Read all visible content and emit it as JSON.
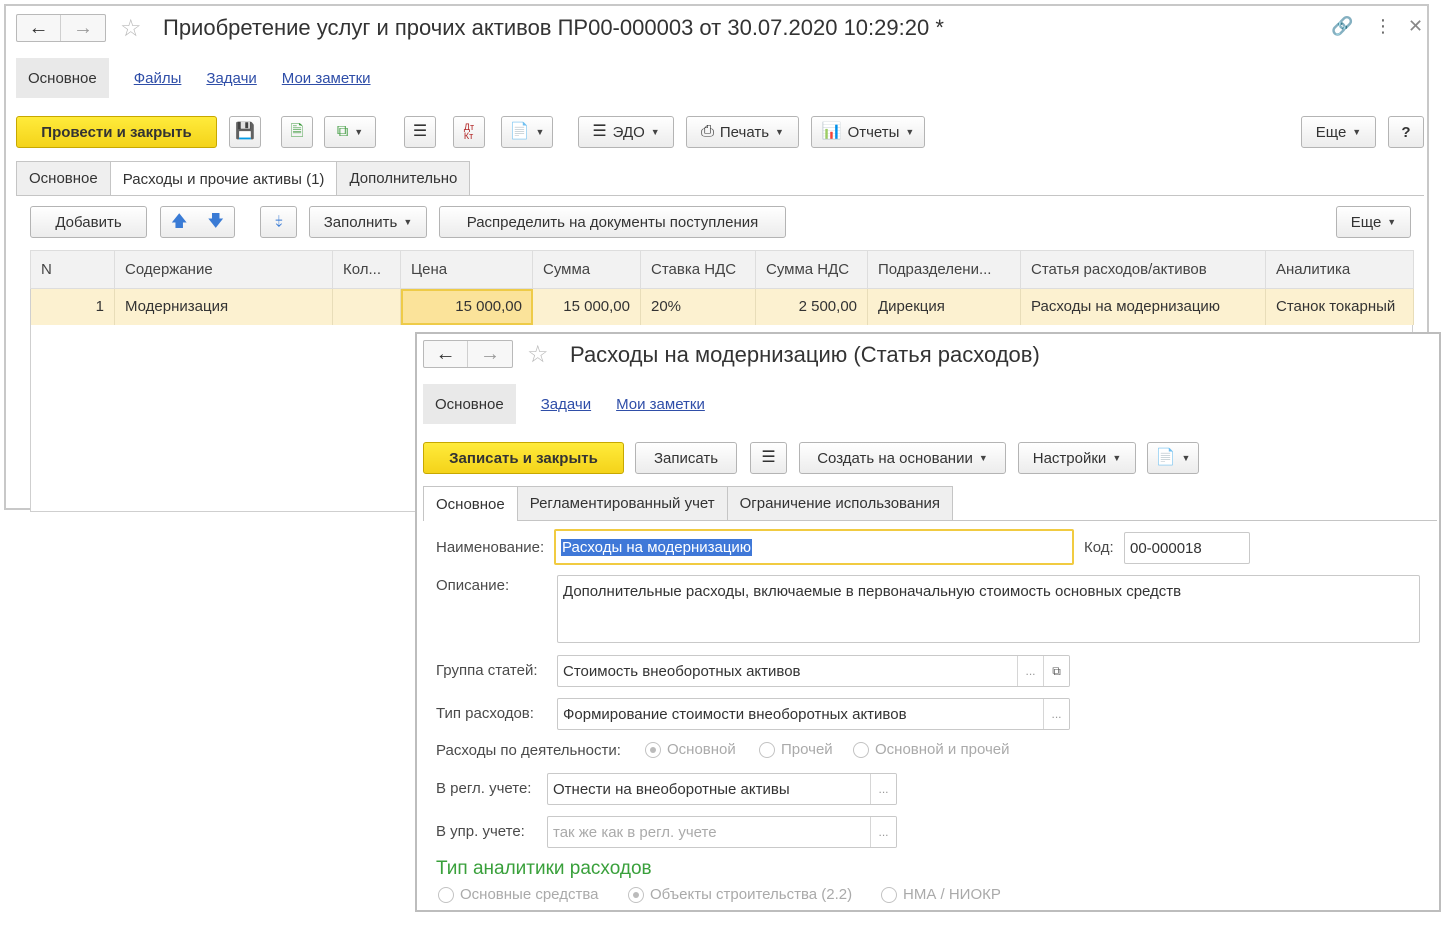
{
  "doc": {
    "title": "Приобретение услуг и прочих активов ПР00-000003 от 30.07.2020 10:29:20 *",
    "nav": {
      "current": "Основное",
      "links": [
        "Файлы",
        "Задачи",
        "Мои заметки"
      ]
    },
    "toolbar": {
      "post_close": "Провести и закрыть",
      "edo": "ЭДО",
      "print": "Печать",
      "reports": "Отчеты",
      "more": "Еще",
      "help": "?"
    },
    "tabs": [
      "Основное",
      "Расходы и прочие активы (1)",
      "Дополнительно"
    ],
    "table_toolbar": {
      "add": "Добавить",
      "fill": "Заполнить",
      "distribute": "Распределить на документы поступления",
      "more": "Еще"
    },
    "columns": [
      "N",
      "Содержание",
      "Кол...",
      "Цена",
      "Сумма",
      "Ставка НДС",
      "Сумма НДС",
      "Подразделени...",
      "Статья расходов/активов",
      "Аналитика"
    ],
    "rows": [
      [
        "1",
        "Модернизация",
        "",
        "15 000,00",
        "15 000,00",
        "20%",
        "2 500,00",
        "Дирекция",
        "Расходы на модернизацию",
        "Станок токарный"
      ]
    ]
  },
  "item": {
    "title": "Расходы на модернизацию (Статья расходов)",
    "nav": {
      "current": "Основное",
      "links": [
        "Задачи",
        "Мои заметки"
      ]
    },
    "toolbar": {
      "save_close": "Записать и закрыть",
      "save": "Записать",
      "create_based": "Создать на основании",
      "settings": "Настройки"
    },
    "tabs": [
      "Основное",
      "Регламентированный учет",
      "Ограничение использования"
    ],
    "form": {
      "name_label": "Наименование:",
      "name_value": "Расходы на модернизацию",
      "code_label": "Код:",
      "code_value": "00-000018",
      "desc_label": "Описание:",
      "desc_value": "Дополнительные расходы, включаемые в первоначальную стоимость основных средств",
      "group_label": "Группа статей:",
      "group_value": "Стоимость внеоборотных активов",
      "type_label": "Тип расходов:",
      "type_value": "Формирование стоимости внеоборотных активов",
      "activity_label": "Расходы по деятельности:",
      "activity_options": [
        "Основной",
        "Прочей",
        "Основной и прочей"
      ],
      "activity_selected": "Основной",
      "regl_label": "В регл. учете:",
      "regl_value": "Отнести на внеоборотные активы",
      "upr_label": "В упр. учете:",
      "upr_placeholder": "так же как в регл. учете",
      "analytics_title": "Тип аналитики расходов",
      "analytics_options": [
        "Основные средства",
        "Объекты строительства (2.2)",
        "НМА / НИОКР"
      ],
      "analytics_selected": "Объекты строительства (2.2)"
    }
  }
}
